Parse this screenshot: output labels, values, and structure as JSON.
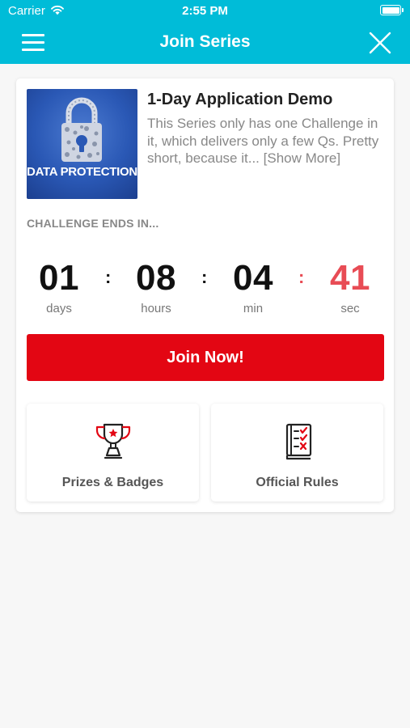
{
  "status_bar": {
    "carrier": "Carrier",
    "time": "2:55 PM",
    "icons": [
      "wifi-icon",
      "battery-icon"
    ]
  },
  "nav": {
    "title": "Join Series",
    "left_icon": "hamburger-menu-icon",
    "right_icon": "close-icon",
    "background_color": "#00bcd8"
  },
  "series": {
    "thumbnail_text": "DATA PROTECTION",
    "title": "1-Day Application Demo",
    "description": "This Series only has one Challenge in it, which delivers only a few Qs.  Pretty short, because it...",
    "show_more": "[Show More]"
  },
  "countdown": {
    "label": "CHALLENGE ENDS IN...",
    "days": "01",
    "days_label": "days",
    "hours": "08",
    "hours_label": "hours",
    "min": "04",
    "min_label": "min",
    "sec": "41",
    "sec_label": "sec",
    "separator": ":",
    "sec_color": "#e84c55"
  },
  "join_button": {
    "label": "Join Now!",
    "color": "#e30613"
  },
  "tiles": {
    "prizes_label": "Prizes & Badges",
    "prizes_icon": "trophy-icon",
    "rules_label": "Official Rules",
    "rules_icon": "rulebook-icon",
    "icon_color": "#e30613"
  }
}
